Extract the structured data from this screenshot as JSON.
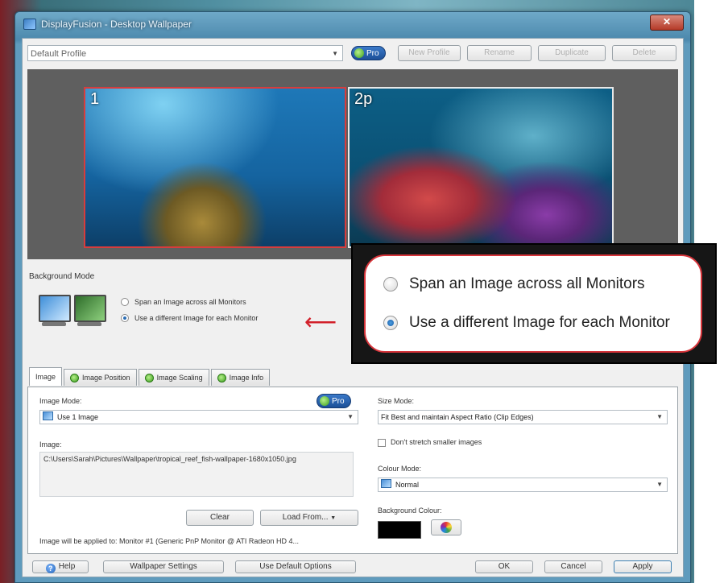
{
  "window": {
    "title": "DisplayFusion - Desktop Wallpaper",
    "close_label": "✕"
  },
  "profile": {
    "selected": "Default Profile",
    "pro_label": "Pro",
    "buttons": {
      "new": "New Profile",
      "rename": "Rename",
      "duplicate": "Duplicate",
      "delete": "Delete"
    }
  },
  "preview": {
    "monitor1_label": "1",
    "monitor2_label": "2p"
  },
  "background_mode": {
    "title": "Background Mode",
    "options": [
      "Span an Image across all Monitors",
      "Use a different Image for each Monitor"
    ],
    "selected_index": 1
  },
  "callout": {
    "options": [
      "Span an Image across all Monitors",
      "Use a different Image for each Monitor"
    ]
  },
  "tabs": [
    "Image",
    "Image Position",
    "Image Scaling",
    "Image Info"
  ],
  "image_tab": {
    "image_mode_label": "Image Mode:",
    "pro_label": "Pro",
    "image_mode_value": "Use 1 Image",
    "image_label": "Image:",
    "image_path": "C:\\Users\\Sarah\\Pictures\\Wallpaper\\tropical_reef_fish-wallpaper-1680x1050.jpg",
    "clear_label": "Clear",
    "load_from_label": "Load From...",
    "applied_to": "Image will be applied to: Monitor #1 (Generic PnP Monitor @ ATI Radeon HD 4...",
    "size_mode_label": "Size Mode:",
    "size_mode_value": "Fit Best and maintain Aspect Ratio (Clip Edges)",
    "dont_stretch_label": "Don't stretch smaller images",
    "colour_mode_label": "Colour Mode:",
    "colour_mode_value": "Normal",
    "background_colour_label": "Background Colour:",
    "background_colour": "#000000"
  },
  "footer": {
    "help": "Help",
    "wallpaper_settings": "Wallpaper Settings",
    "use_default_options": "Use Default Options",
    "ok": "OK",
    "cancel": "Cancel",
    "apply": "Apply"
  },
  "colors": {
    "accent_red": "#d6343a",
    "pro_blue": "#1c4f97"
  },
  "icons": [
    "app-icon",
    "close-icon",
    "chevron-down-icon",
    "pro-icon",
    "monitor-span-icon",
    "monitor-different-icon",
    "arrow-left-icon",
    "help-icon",
    "colour-wheel-icon"
  ]
}
